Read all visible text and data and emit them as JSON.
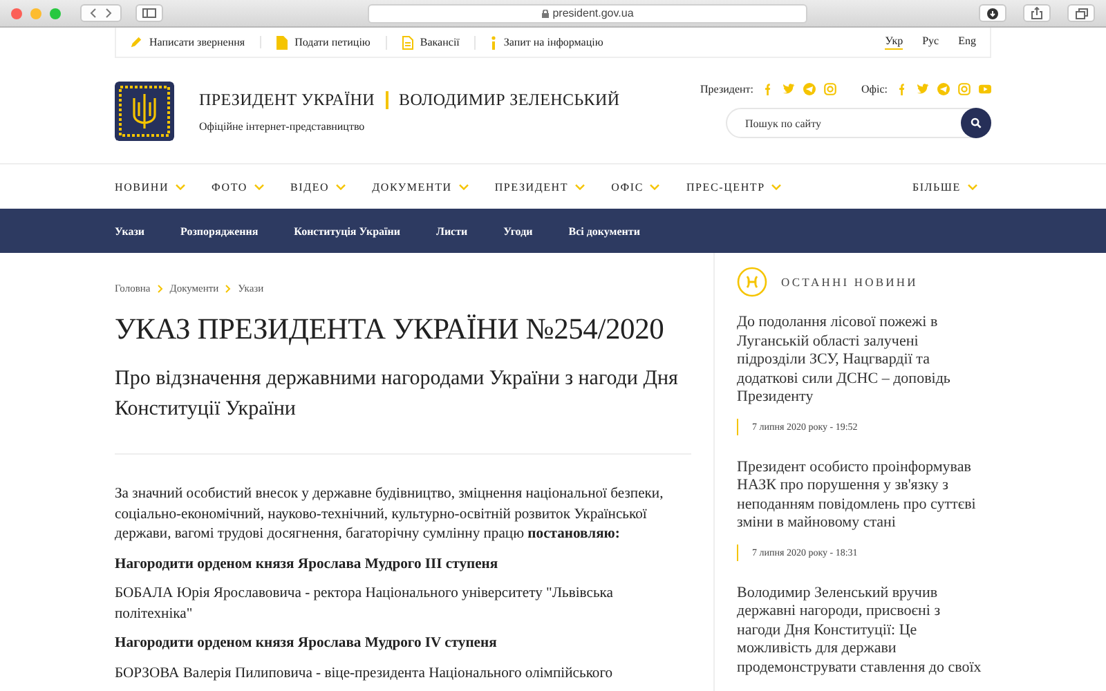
{
  "browser": {
    "url": "president.gov.ua"
  },
  "top_links": [
    {
      "label": "Написати звернення",
      "kind": "pencil"
    },
    {
      "label": "Подати петицію",
      "kind": "file"
    },
    {
      "label": "Вакансії",
      "kind": "doc"
    },
    {
      "label": "Запит на інформацію",
      "kind": "info"
    }
  ],
  "languages": [
    {
      "label": "Укр",
      "selected": true
    },
    {
      "label": "Рус",
      "selected": false
    },
    {
      "label": "Eng",
      "selected": false
    }
  ],
  "header": {
    "title": "ПРЕЗИДЕНТ УКРАЇНИ",
    "name": "ВОЛОДИМИР ЗЕЛЕНСЬКИЙ",
    "subtitle": "Офіційне інтернет-представництво",
    "social_groups": [
      {
        "label": "Президент:",
        "icons": [
          {
            "kind": "facebook"
          },
          {
            "kind": "twitter"
          },
          {
            "kind": "telegram"
          },
          {
            "kind": "instagram"
          }
        ]
      },
      {
        "label": "Офіс:",
        "icons": [
          {
            "kind": "facebook"
          },
          {
            "kind": "twitter"
          },
          {
            "kind": "telegram"
          },
          {
            "kind": "instagram"
          },
          {
            "kind": "youtube"
          }
        ]
      }
    ],
    "search": {
      "placeholder": "Пошук по сайту"
    }
  },
  "nav": [
    "НОВИНИ",
    "ФОТО",
    "ВІДЕО",
    "ДОКУМЕНТИ",
    "ПРЕЗИДЕНТ",
    "ОФІС",
    "ПРЕС-ЦЕНТР"
  ],
  "nav_more": "БІЛЬШЕ",
  "subnav": [
    "Укази",
    "Розпорядження",
    "Конституція України",
    "Листи",
    "Угоди",
    "Всі документи"
  ],
  "breadcrumbs": [
    "Головна",
    "Документи",
    "Укази"
  ],
  "title": "УКАЗ ПРЕЗИДЕНТА УКРАЇНИ №254/2020",
  "subtitle": "Про відзначення державними нагородами України з нагоди Дня Конституції України",
  "body": [
    {
      "kind": "paragraph",
      "text": "За значний особистий внесок у державне будівництво, зміцнення національної безпеки, соціально-економічний, науково-технічний, культурно-освітній розвиток Української держави, вагомі трудові досягнення, багаторічну сумлінну працю **постановляю:**"
    },
    {
      "kind": "heading",
      "text": "Нагородити орденом князя Ярослава Мудрого III ступеня"
    },
    {
      "kind": "paragraph",
      "text": "БОБАЛА Юрія Ярославовича - ректора Національного університету \"Львівська політехніка\""
    },
    {
      "kind": "heading",
      "text": "Нагородити орденом князя Ярослава Мудрого IV ступеня"
    },
    {
      "kind": "paragraph",
      "text": "БОРЗОВА Валерія Пилиповича - віце-президента Національного олімпійського"
    }
  ],
  "sidebar": {
    "title": "ОСТАННІ НОВИНИ",
    "news": [
      {
        "title": "До подолання лісової пожежі в Луганській області залучені підрозділи ЗСУ, Нацгвардії та додаткові сили ДСНС – доповідь Президенту",
        "date": "7 липня 2020 року - 19:52"
      },
      {
        "title": "Президент особисто проінформував НАЗК про порушення у зв'язку з неподанням повідомлень про суттєві зміни в майновому стані",
        "date": "7 липня 2020 року - 18:31"
      },
      {
        "title": "Володимир Зеленський вручив державні нагороди, присвоєні з нагоди Дня Конституції: Це можливість для держави продемонструвати ставлення до своїх"
      }
    ]
  }
}
